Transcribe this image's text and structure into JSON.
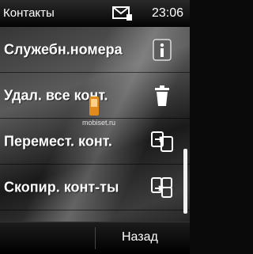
{
  "status_bar": {
    "title": "Контакты",
    "time": "23:06",
    "message_icon": "envelope-icon"
  },
  "menu": {
    "items": [
      {
        "label": "Служебн.номера",
        "icon": "info-icon"
      },
      {
        "label": "Удал. все конт.",
        "icon": "trash-icon"
      },
      {
        "label": "Перемест. конт.",
        "icon": "move-contacts-icon"
      },
      {
        "label": "Скопир. конт-ты",
        "icon": "copy-contacts-icon"
      }
    ]
  },
  "watermark": {
    "text": "mobiset.ru"
  },
  "softkeys": {
    "right": "Назад"
  }
}
